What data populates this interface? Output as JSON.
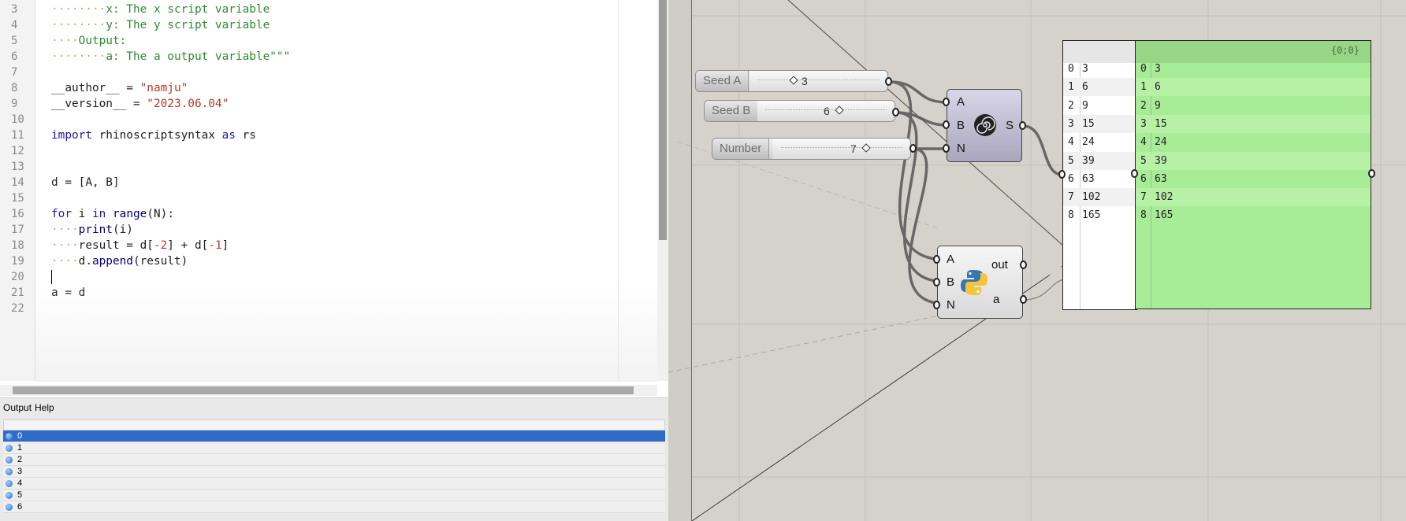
{
  "editor": {
    "lines": [
      {
        "n": "3",
        "segments": [
          {
            "t": "········",
            "c": "dots"
          },
          {
            "t": "x: The x script variable",
            "c": "cm"
          }
        ]
      },
      {
        "n": "4",
        "segments": [
          {
            "t": "········",
            "c": "dots"
          },
          {
            "t": "y: The y script variable",
            "c": "cm"
          }
        ]
      },
      {
        "n": "5",
        "segments": [
          {
            "t": "····",
            "c": "dots"
          },
          {
            "t": "Output:",
            "c": "cm"
          }
        ]
      },
      {
        "n": "6",
        "segments": [
          {
            "t": "········",
            "c": "dots"
          },
          {
            "t": "a: The a output variable\"\"\"",
            "c": "cm"
          }
        ]
      },
      {
        "n": "7",
        "segments": []
      },
      {
        "n": "8",
        "segments": [
          {
            "t": "__author__ = ",
            "c": ""
          },
          {
            "t": "\"namju\"",
            "c": "str"
          }
        ]
      },
      {
        "n": "9",
        "segments": [
          {
            "t": "__version__ = ",
            "c": ""
          },
          {
            "t": "\"2023.06.04\"",
            "c": "str"
          }
        ]
      },
      {
        "n": "10",
        "segments": []
      },
      {
        "n": "11",
        "segments": [
          {
            "t": "import",
            "c": "kw"
          },
          {
            "t": " rhinoscriptsyntax ",
            "c": ""
          },
          {
            "t": "as",
            "c": "kw"
          },
          {
            "t": " rs",
            "c": ""
          }
        ]
      },
      {
        "n": "12",
        "segments": []
      },
      {
        "n": "13",
        "segments": []
      },
      {
        "n": "14",
        "segments": [
          {
            "t": "d = [A, B]",
            "c": ""
          }
        ]
      },
      {
        "n": "15",
        "segments": []
      },
      {
        "n": "16",
        "segments": [
          {
            "t": "for",
            "c": "kw"
          },
          {
            "t": " i ",
            "c": ""
          },
          {
            "t": "in",
            "c": "kw"
          },
          {
            "t": " ",
            "c": ""
          },
          {
            "t": "range",
            "c": "fn"
          },
          {
            "t": "(N):",
            "c": ""
          }
        ]
      },
      {
        "n": "17",
        "segments": [
          {
            "t": "····",
            "c": "dots"
          },
          {
            "t": "print",
            "c": "fn"
          },
          {
            "t": "(i)",
            "c": ""
          }
        ]
      },
      {
        "n": "18",
        "segments": [
          {
            "t": "····",
            "c": "dots"
          },
          {
            "t": "result = d[",
            "c": ""
          },
          {
            "t": "-2",
            "c": "num"
          },
          {
            "t": "] + d[",
            "c": ""
          },
          {
            "t": "-1",
            "c": "num"
          },
          {
            "t": "]",
            "c": ""
          }
        ]
      },
      {
        "n": "19",
        "segments": [
          {
            "t": "····",
            "c": "dots"
          },
          {
            "t": "d.",
            "c": ""
          },
          {
            "t": "append",
            "c": "fn"
          },
          {
            "t": "(result)",
            "c": ""
          }
        ]
      },
      {
        "n": "20",
        "segments": [],
        "caret": true
      },
      {
        "n": "21",
        "segments": [
          {
            "t": "a = d",
            "c": ""
          }
        ]
      },
      {
        "n": "22",
        "segments": []
      }
    ]
  },
  "output_panel": {
    "tabs": [
      "Output",
      "Help"
    ],
    "rows": [
      "0",
      "1",
      "2",
      "3",
      "4",
      "5",
      "6"
    ],
    "selected_index": 0
  },
  "canvas": {
    "sliders": [
      {
        "label": "Seed A",
        "value": "3"
      },
      {
        "label": "Seed B",
        "value": "6"
      },
      {
        "label": "Number",
        "value": "7"
      }
    ],
    "fib_component": {
      "inputs": [
        "A",
        "B",
        "N"
      ],
      "outputs": [
        "S"
      ],
      "icon": "spiral-icon"
    },
    "python_component": {
      "inputs": [
        "A",
        "B",
        "N"
      ],
      "outputs": [
        "out",
        "a"
      ],
      "icon": "python-logo-icon"
    },
    "panel_white": {
      "rows": [
        {
          "i": "0",
          "v": "3"
        },
        {
          "i": "1",
          "v": "6"
        },
        {
          "i": "2",
          "v": "9"
        },
        {
          "i": "3",
          "v": "15"
        },
        {
          "i": "4",
          "v": "24"
        },
        {
          "i": "5",
          "v": "39"
        },
        {
          "i": "6",
          "v": "63"
        },
        {
          "i": "7",
          "v": "102"
        },
        {
          "i": "8",
          "v": "165"
        }
      ]
    },
    "panel_green": {
      "path": "{0;0}",
      "rows": [
        {
          "i": "0",
          "v": "3"
        },
        {
          "i": "1",
          "v": "6"
        },
        {
          "i": "2",
          "v": "9"
        },
        {
          "i": "3",
          "v": "15"
        },
        {
          "i": "4",
          "v": "24"
        },
        {
          "i": "5",
          "v": "39"
        },
        {
          "i": "6",
          "v": "63"
        },
        {
          "i": "7",
          "v": "102"
        },
        {
          "i": "8",
          "v": "165"
        }
      ]
    }
  },
  "colors": {
    "selection": "#2f6cc7",
    "panel_green": "#a9ec97",
    "keyword": "#1a1aa6",
    "string": "#b13b2e",
    "comment": "#2e8b2e"
  }
}
